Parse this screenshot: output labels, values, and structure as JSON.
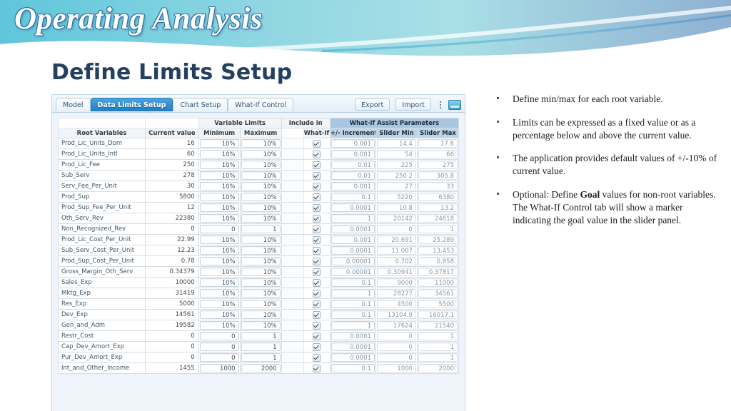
{
  "slide": {
    "banner_title": "Operating Analysis",
    "subtitle": "Define Limits Setup",
    "accent_color": "#2e6ea6",
    "banner_teal": "#6ecbdc",
    "banner_blue": "#8fb8d8",
    "subtitle_color": "#24405e"
  },
  "app": {
    "tabs": [
      {
        "label": "Model",
        "active": false
      },
      {
        "label": "Data Limits Setup",
        "active": true
      },
      {
        "label": "Chart Setup",
        "active": false
      },
      {
        "label": "What-If Control",
        "active": false
      }
    ],
    "tools": {
      "export_label": "Export",
      "import_label": "Import",
      "menu_icon": "vertical-dots-icon",
      "window_icon": "window-icon"
    },
    "grid": {
      "group_headers": {
        "variable_limits": "Variable Limits",
        "include_in": "Include in",
        "what_if_assist": "What-If Assist Parameters"
      },
      "columns": [
        "Root Variables",
        "Current value",
        "Minimum",
        "Maximum",
        "What-If?",
        "+/- Increment",
        "Slider Min",
        "Slider Max"
      ],
      "rows": [
        {
          "name": "Prod_Lic_Units_Dom",
          "current": "16",
          "min": "10%",
          "max": "10%",
          "checked": true,
          "increment": "0.001",
          "slider_min": "14.4",
          "slider_max": "17.6"
        },
        {
          "name": "Prod_Lic_Units_Intl",
          "current": "60",
          "min": "10%",
          "max": "10%",
          "checked": true,
          "increment": "0.001",
          "slider_min": "54",
          "slider_max": "66"
        },
        {
          "name": "Prod_Lic_Fee",
          "current": "250",
          "min": "10%",
          "max": "10%",
          "checked": true,
          "increment": "0.01",
          "slider_min": "225",
          "slider_max": "275"
        },
        {
          "name": "Sub_Serv",
          "current": "278",
          "min": "10%",
          "max": "10%",
          "checked": true,
          "increment": "0.01",
          "slider_min": "250.2",
          "slider_max": "305.8"
        },
        {
          "name": "Serv_Fee_Per_Unit",
          "current": "30",
          "min": "10%",
          "max": "10%",
          "checked": true,
          "increment": "0.001",
          "slider_min": "27",
          "slider_max": "33"
        },
        {
          "name": "Prod_Sup",
          "current": "5800",
          "min": "10%",
          "max": "10%",
          "checked": true,
          "increment": "0.1",
          "slider_min": "5220",
          "slider_max": "6380"
        },
        {
          "name": "Prod_Sup_Fee_Per_Unit",
          "current": "12",
          "min": "10%",
          "max": "10%",
          "checked": true,
          "increment": "0.0001",
          "slider_min": "10.8",
          "slider_max": "13.2"
        },
        {
          "name": "Oth_Serv_Rev",
          "current": "22380",
          "min": "10%",
          "max": "10%",
          "checked": true,
          "increment": "1",
          "slider_min": "20142",
          "slider_max": "24618"
        },
        {
          "name": "Non_Recognized_Rev",
          "current": "0",
          "min": "0",
          "max": "1",
          "checked": true,
          "increment": "0.0001",
          "slider_min": "0",
          "slider_max": "1"
        },
        {
          "name": "Prod_Lic_Cost_Per_Unit",
          "current": "22.99",
          "min": "10%",
          "max": "10%",
          "checked": true,
          "increment": "0.001",
          "slider_min": "20.691",
          "slider_max": "25.289"
        },
        {
          "name": "Sub_Serv_Cost_Per_Unit",
          "current": "12.23",
          "min": "10%",
          "max": "10%",
          "checked": true,
          "increment": "0.0001",
          "slider_min": "11.007",
          "slider_max": "13.453"
        },
        {
          "name": "Prod_Sup_Cost_Per_Unit",
          "current": "0.78",
          "min": "10%",
          "max": "10%",
          "checked": true,
          "increment": "0.00001",
          "slider_min": "0.702",
          "slider_max": "0.858"
        },
        {
          "name": "Gross_Margin_Oth_Serv",
          "current": "0.34379",
          "min": "10%",
          "max": "10%",
          "checked": true,
          "increment": "0.00001",
          "slider_min": "0.30941",
          "slider_max": "0.37817"
        },
        {
          "name": "Sales_Exp",
          "current": "10000",
          "min": "10%",
          "max": "10%",
          "checked": true,
          "increment": "0.1",
          "slider_min": "9000",
          "slider_max": "11000"
        },
        {
          "name": "Mktg_Exp",
          "current": "31419",
          "min": "10%",
          "max": "10%",
          "checked": true,
          "increment": "1",
          "slider_min": "28277",
          "slider_max": "34561"
        },
        {
          "name": "Res_Exp",
          "current": "5000",
          "min": "10%",
          "max": "10%",
          "checked": true,
          "increment": "0.1",
          "slider_min": "4500",
          "slider_max": "5500"
        },
        {
          "name": "Dev_Exp",
          "current": "14561",
          "min": "10%",
          "max": "10%",
          "checked": true,
          "increment": "0.1",
          "slider_min": "13104.9",
          "slider_max": "16017.1"
        },
        {
          "name": "Gen_and_Adm",
          "current": "19582",
          "min": "10%",
          "max": "10%",
          "checked": true,
          "increment": "1",
          "slider_min": "17624",
          "slider_max": "21540"
        },
        {
          "name": "Restr_Cost",
          "current": "0",
          "min": "0",
          "max": "1",
          "checked": true,
          "increment": "0.0001",
          "slider_min": "0",
          "slider_max": "1"
        },
        {
          "name": "Cap_Dev_Amort_Exp",
          "current": "0",
          "min": "0",
          "max": "1",
          "checked": true,
          "increment": "0.0001",
          "slider_min": "0",
          "slider_max": "1"
        },
        {
          "name": "Pur_Dev_Amort_Exp",
          "current": "0",
          "min": "0",
          "max": "1",
          "checked": true,
          "increment": "0.0001",
          "slider_min": "0",
          "slider_max": "1"
        },
        {
          "name": "Int_and_Other_Income",
          "current": "1455",
          "min": "1000",
          "max": "2000",
          "checked": true,
          "increment": "0.1",
          "slider_min": "1000",
          "slider_max": "2000"
        }
      ]
    }
  },
  "bullets": [
    {
      "html": "Define min/max for each root variable."
    },
    {
      "html": "Limits can be expressed as a fixed value or as a percentage below and above the current value."
    },
    {
      "html": "The application provides default values of +/-10% of current value."
    },
    {
      "html": "Optional: Define <b>Goal</b> values for non-root variables. The What-If Control tab will show a marker indicating the goal value in the slider panel."
    }
  ]
}
